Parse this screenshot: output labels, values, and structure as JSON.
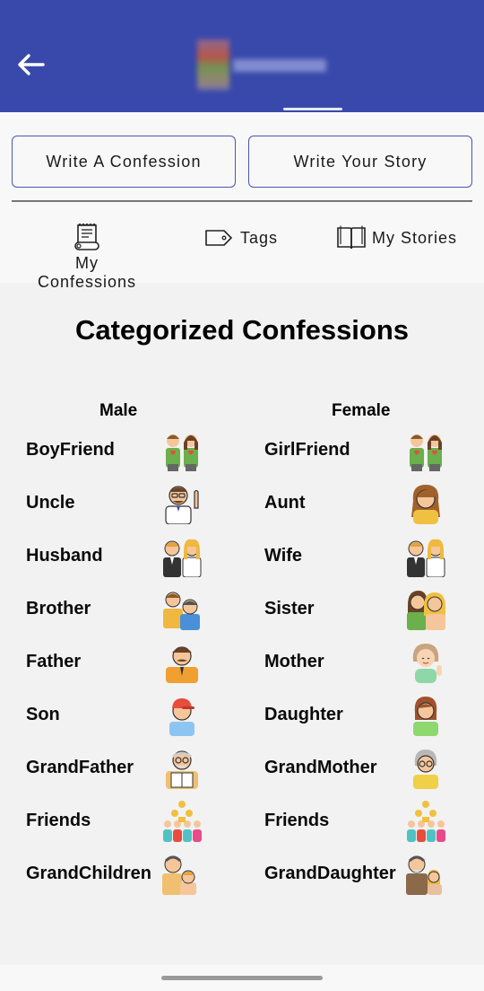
{
  "buttons": {
    "write_confession": "Write A Confession",
    "write_story": "Write Your Story"
  },
  "tabs": {
    "my_confessions_line1": "My",
    "my_confessions_line2": "Confessions",
    "tags": "Tags",
    "my_stories": "My Stories"
  },
  "section_title": "Categorized Confessions",
  "columns": {
    "male_header": "Male",
    "female_header": "Female",
    "male": [
      {
        "label": "BoyFriend",
        "icon": "couple-icon"
      },
      {
        "label": "Uncle",
        "icon": "uncle-icon"
      },
      {
        "label": "Husband",
        "icon": "wedding-couple-icon"
      },
      {
        "label": "Brother",
        "icon": "brothers-icon"
      },
      {
        "label": "Father",
        "icon": "father-icon"
      },
      {
        "label": "Son",
        "icon": "boy-icon"
      },
      {
        "label": "GrandFather",
        "icon": "grandfather-icon"
      },
      {
        "label": "Friends",
        "icon": "group-icon"
      },
      {
        "label": "GrandChildren",
        "icon": "grandparent-child-icon"
      }
    ],
    "female": [
      {
        "label": "GirlFriend",
        "icon": "couple-icon"
      },
      {
        "label": "Aunt",
        "icon": "aunt-icon"
      },
      {
        "label": "Wife",
        "icon": "wedding-couple-icon"
      },
      {
        "label": "Sister",
        "icon": "sisters-icon"
      },
      {
        "label": "Mother",
        "icon": "mother-icon"
      },
      {
        "label": "Daughter",
        "icon": "girl-icon"
      },
      {
        "label": "GrandMother",
        "icon": "grandmother-icon"
      },
      {
        "label": "Friends",
        "icon": "group-icon"
      },
      {
        "label": "GrandDaughter",
        "icon": "grandparent-child-icon"
      }
    ]
  },
  "colors": {
    "app_bar": "#3949ab",
    "button_border": "#4a55b0",
    "background": "#f2f2f2"
  }
}
